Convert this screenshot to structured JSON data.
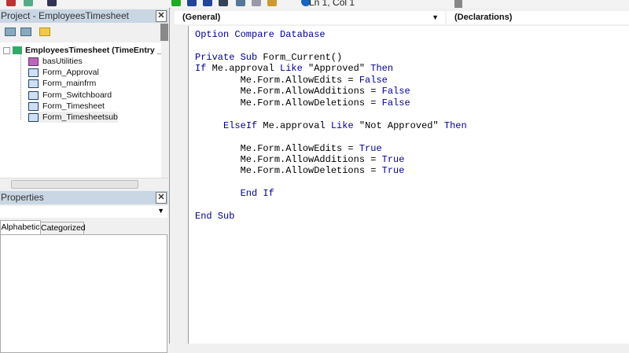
{
  "status": {
    "position": "Ln 1, Col 1"
  },
  "project": {
    "title": "Project - EmployeesTimesheet",
    "root": "EmployeesTimesheet (TimeEntry _Upd:",
    "items": [
      "basUtilities",
      "Form_Approval",
      "Form_mainfrm",
      "Form_Switchboard",
      "Form_Timesheet",
      "Form_Timesheetsub"
    ]
  },
  "properties": {
    "title": "Properties",
    "tabs": [
      "Alphabetic",
      "Categorized"
    ]
  },
  "close_label": "✕",
  "code": {
    "object_combo": "(General)",
    "proc_combo": "(Declarations)",
    "lines": [
      [
        [
          "Option Compare Database",
          1
        ]
      ],
      [],
      [
        [
          "Private Sub",
          1
        ],
        [
          " Form_Current()",
          0
        ]
      ],
      [
        [
          "If",
          1
        ],
        [
          " Me.approval ",
          0
        ],
        [
          "Like",
          1
        ],
        [
          " \"Approved\" ",
          0
        ],
        [
          "Then",
          1
        ]
      ],
      [
        [
          "        Me.Form.AllowEdits = ",
          0
        ],
        [
          "False",
          1
        ]
      ],
      [
        [
          "        Me.Form.AllowAdditions = ",
          0
        ],
        [
          "False",
          1
        ]
      ],
      [
        [
          "        Me.Form.AllowDeletions = ",
          0
        ],
        [
          "False",
          1
        ]
      ],
      [],
      [
        [
          "     ",
          0
        ],
        [
          "ElseIf",
          1
        ],
        [
          " Me.approval ",
          0
        ],
        [
          "Like",
          1
        ],
        [
          " \"Not Approved\" ",
          0
        ],
        [
          "Then",
          1
        ]
      ],
      [],
      [
        [
          "        Me.Form.AllowEdits = ",
          0
        ],
        [
          "True",
          1
        ]
      ],
      [
        [
          "        Me.Form.AllowAdditions = ",
          0
        ],
        [
          "True",
          1
        ]
      ],
      [
        [
          "        Me.Form.AllowDeletions = ",
          0
        ],
        [
          "True",
          1
        ]
      ],
      [],
      [
        [
          "        ",
          0
        ],
        [
          "End If",
          1
        ]
      ],
      [],
      [
        [
          "End Sub",
          1
        ]
      ]
    ]
  }
}
